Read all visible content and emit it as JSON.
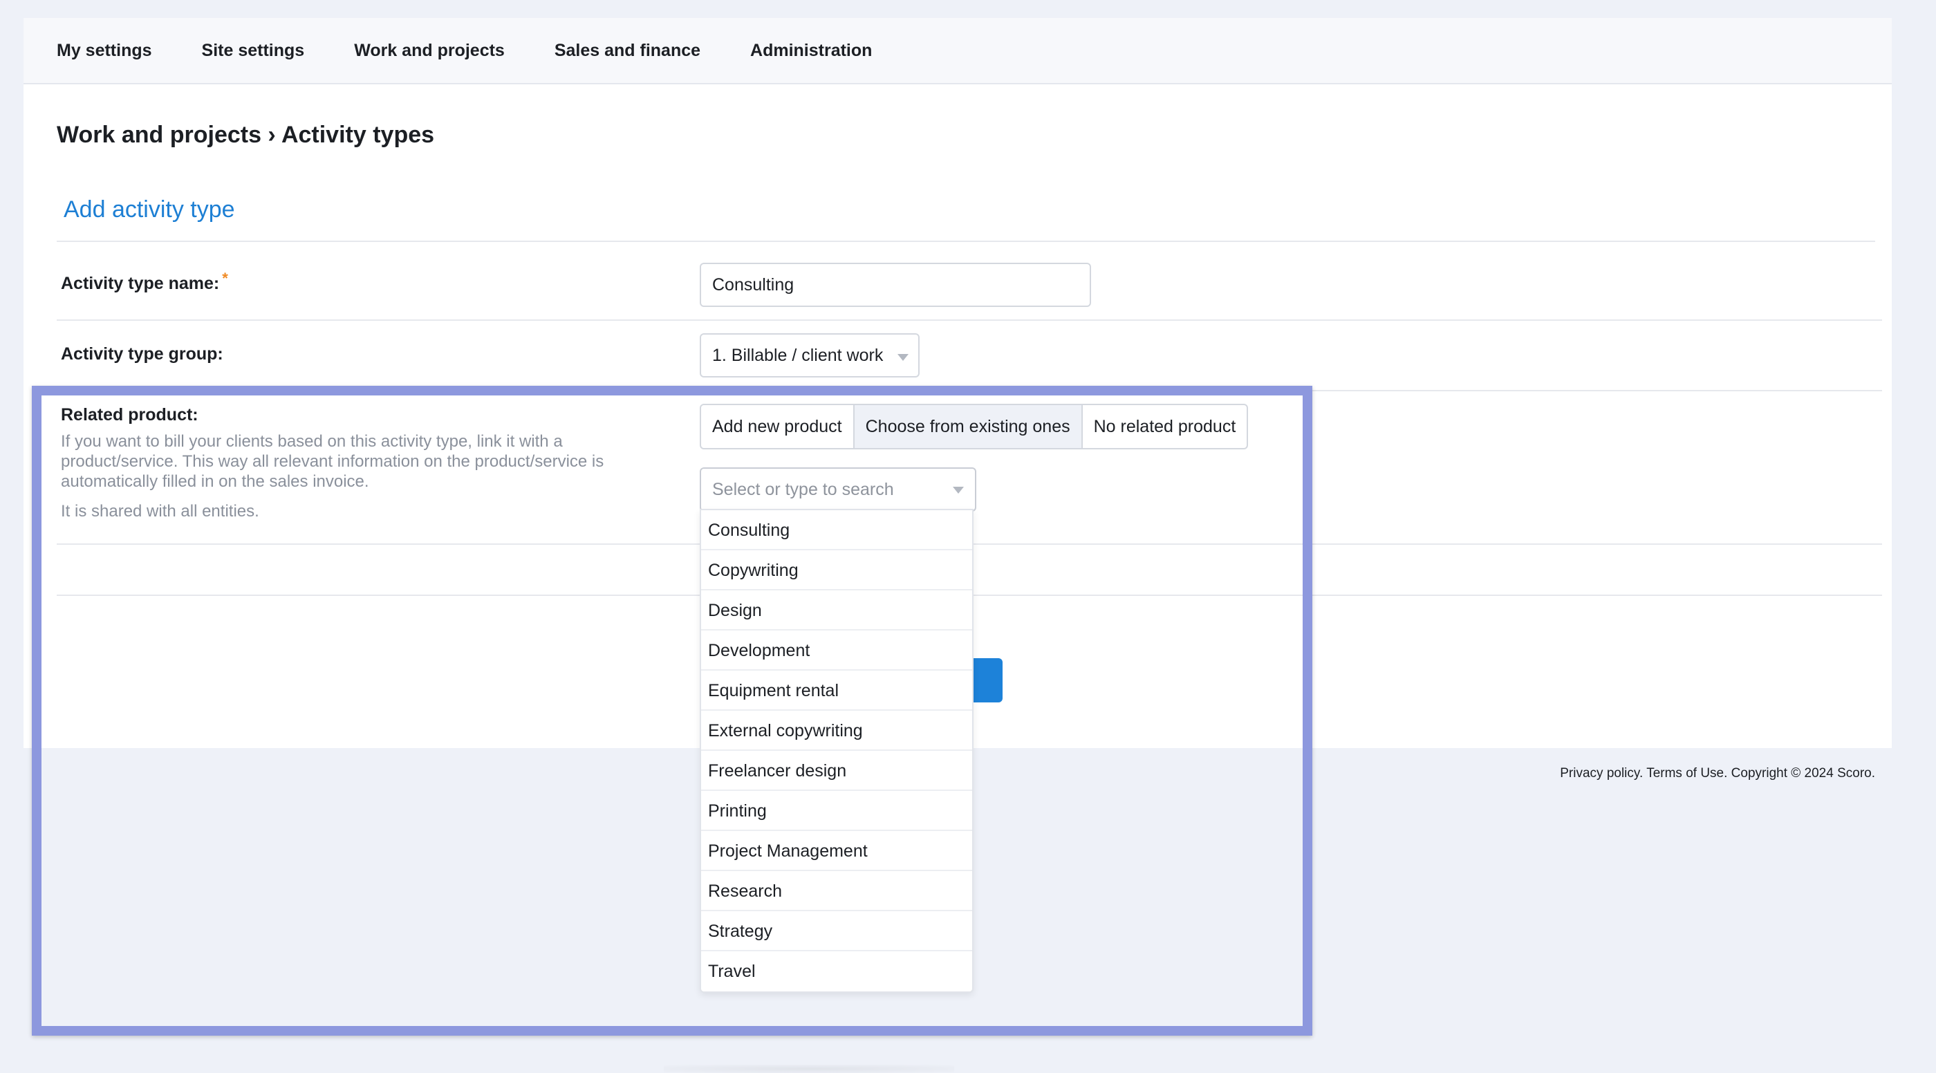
{
  "nav": {
    "items": [
      {
        "label": "My settings"
      },
      {
        "label": "Site settings"
      },
      {
        "label": "Work and projects"
      },
      {
        "label": "Sales and finance"
      },
      {
        "label": "Administration"
      }
    ]
  },
  "page": {
    "breadcrumb": "Work and projects › Activity types",
    "section_title": "Add activity type"
  },
  "form": {
    "name_label": "Activity type name:",
    "required_mark": "*",
    "name_value": "Consulting",
    "group_label": "Activity type group:",
    "group_value": "1. Billable / client work",
    "product_label": "Related product:",
    "product_help": "If you want to bill your clients based on this activity type, link it with a product/service. This way all relevant information on the product/service is automatically filled in on the sales invoice.",
    "product_shared": "It is shared with all entities.",
    "product_modes": [
      {
        "label": "Add new product",
        "active": false
      },
      {
        "label": "Choose from existing ones",
        "active": true
      },
      {
        "label": "No related product",
        "active": false
      }
    ],
    "search_placeholder": "Select or type to search",
    "options": [
      "Consulting",
      "Copywriting",
      "Design",
      "Development",
      "Equipment rental",
      "External copywriting",
      "Freelancer design",
      "Printing",
      "Project Management",
      "Research",
      "Strategy",
      "Travel"
    ]
  },
  "footer": {
    "text": "Privacy policy. Terms of Use. Copyright © 2024 Scoro."
  },
  "colors": {
    "accent": "#1d82d9",
    "link": "#1d7fd4",
    "highlight_frame": "#8d98de",
    "required": "#f08a24",
    "background": "#eef1f8"
  }
}
